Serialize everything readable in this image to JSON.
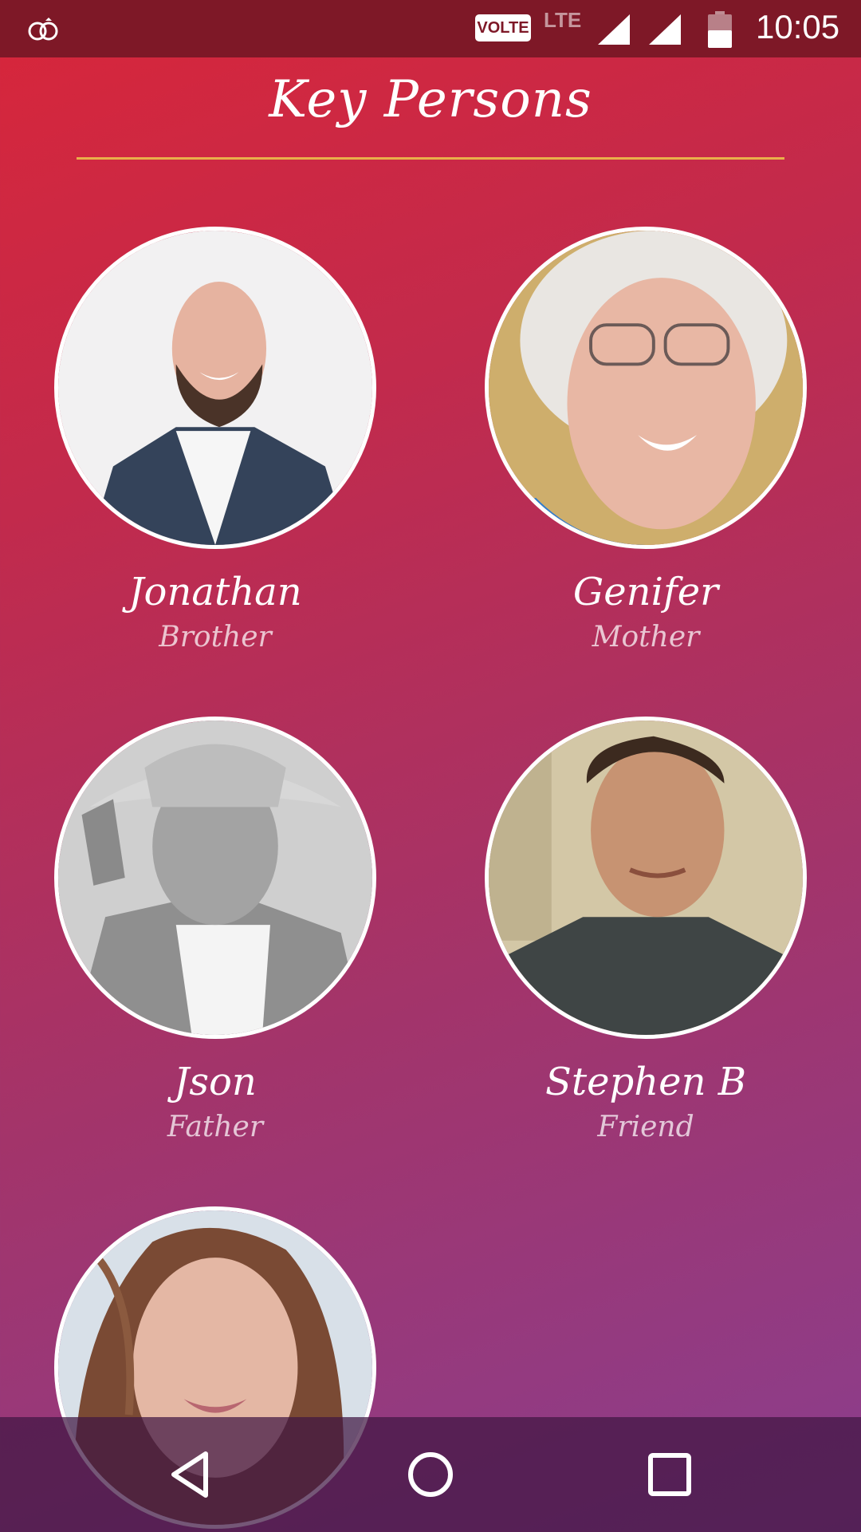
{
  "status_bar": {
    "volte": "VOLTE",
    "network": "LTE",
    "time": "10:05",
    "icons": [
      "rings-icon",
      "signal-icon",
      "signal-icon",
      "battery-icon"
    ]
  },
  "header": {
    "title": "Key Persons"
  },
  "persons": [
    {
      "name": "Jonathan",
      "relation": "Brother",
      "avatar": "photo-bald-bearded-man"
    },
    {
      "name": "Genifer",
      "relation": "Mother",
      "avatar": "photo-elderly-woman-glasses"
    },
    {
      "name": "Json",
      "relation": "Father",
      "avatar": "photo-man-cowboy-hat"
    },
    {
      "name": "Stephen B",
      "relation": "Friend",
      "avatar": "photo-young-man"
    },
    {
      "name": "",
      "relation": "",
      "avatar": "photo-young-woman"
    }
  ],
  "nav": {
    "icons": [
      "back-icon",
      "home-icon",
      "recents-icon"
    ]
  },
  "colors": {
    "status_bar": "#7e1827",
    "gradient_top": "#d8263a",
    "gradient_bottom": "#8a3e8e",
    "title_rule": "#e9b04a"
  }
}
